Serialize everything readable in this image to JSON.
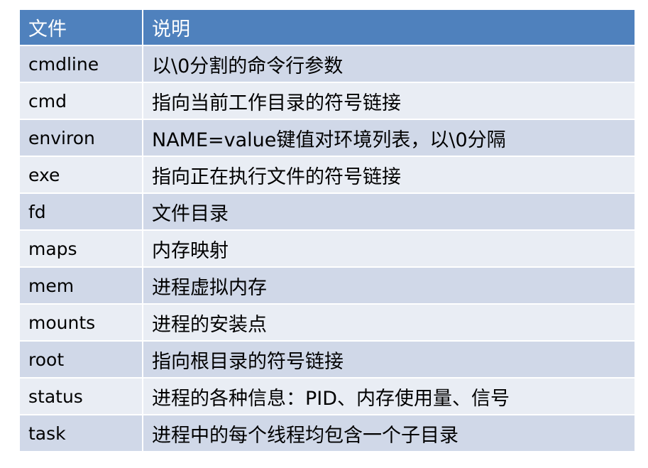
{
  "table": {
    "headers": {
      "file": "文件",
      "description": "说明"
    },
    "rows": [
      {
        "file": "cmdline",
        "description": "以\\0分割的命令行参数"
      },
      {
        "file": "cmd",
        "description": "指向当前工作目录的符号链接"
      },
      {
        "file": "environ",
        "description": "NAME=value键值对环境列表，以\\0分隔"
      },
      {
        "file": "exe",
        "description": "指向正在执行文件的符号链接"
      },
      {
        "file": "fd",
        "description": "文件目录"
      },
      {
        "file": "maps",
        "description": "内存映射"
      },
      {
        "file": "mem",
        "description": "进程虚拟内存"
      },
      {
        "file": "mounts",
        "description": "进程的安装点"
      },
      {
        "file": "root",
        "description": "指向根目录的符号链接"
      },
      {
        "file": "status",
        "description": "进程的各种信息：PID、内存使用量、信号"
      },
      {
        "file": "task",
        "description": "进程中的每个线程均包含一个子目录"
      }
    ],
    "colors": {
      "header_bg": "#4f81bd",
      "row_odd_bg": "#d0d8e8",
      "row_even_bg": "#e9edf4",
      "header_text": "#ffffff"
    }
  }
}
